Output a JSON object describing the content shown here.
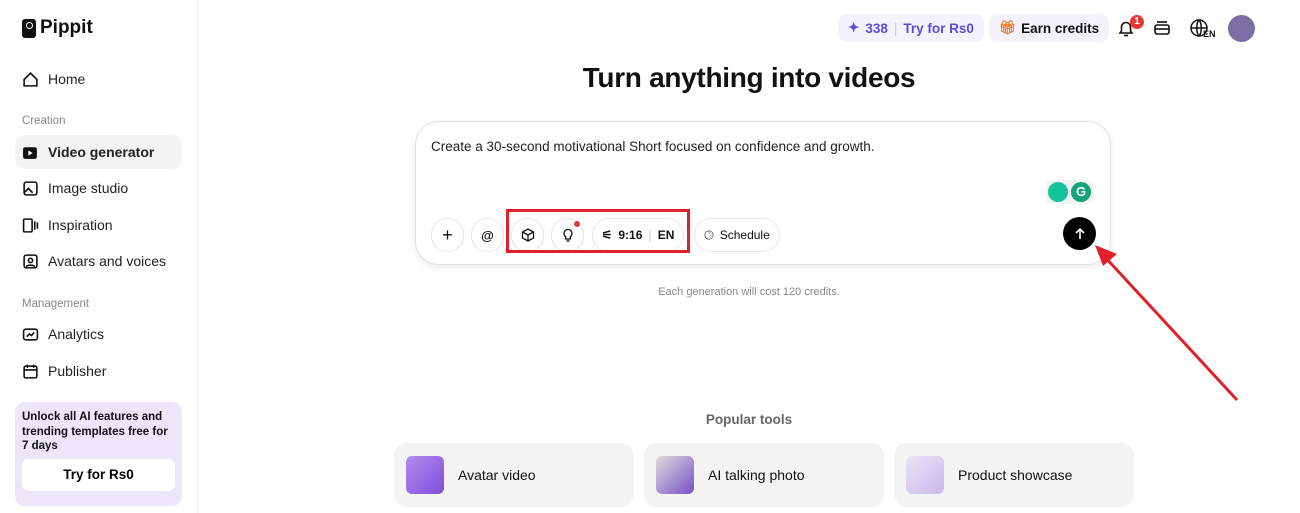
{
  "brand": "Pippit",
  "sidebar": {
    "home": "Home",
    "creation": "Creation",
    "items": [
      "Video generator",
      "Image studio",
      "Inspiration",
      "Avatars and voices"
    ],
    "management": "Management",
    "items2": [
      "Analytics",
      "Publisher"
    ],
    "promo_text": "Unlock all AI features and trending templates free for 7 days",
    "promo_button": "Try for Rs0"
  },
  "header": {
    "credits": "338",
    "try": "Try for Rs0",
    "earn": "Earn credits",
    "notif_count": "1",
    "lang": "EN"
  },
  "main": {
    "title": "Turn anything into videos",
    "prompt": "Create a 30-second motivational Short focused on confidence and growth.",
    "ratio": "9:16",
    "lang": "EN",
    "schedule": "Schedule",
    "cost": "Each generation will cost 120 credits.",
    "popular": "Popular tools",
    "tools": [
      "Avatar video",
      "AI talking photo",
      "Product showcase"
    ]
  },
  "colors": {
    "accent": "#5b4bdb",
    "annotation": "#e0202a"
  }
}
